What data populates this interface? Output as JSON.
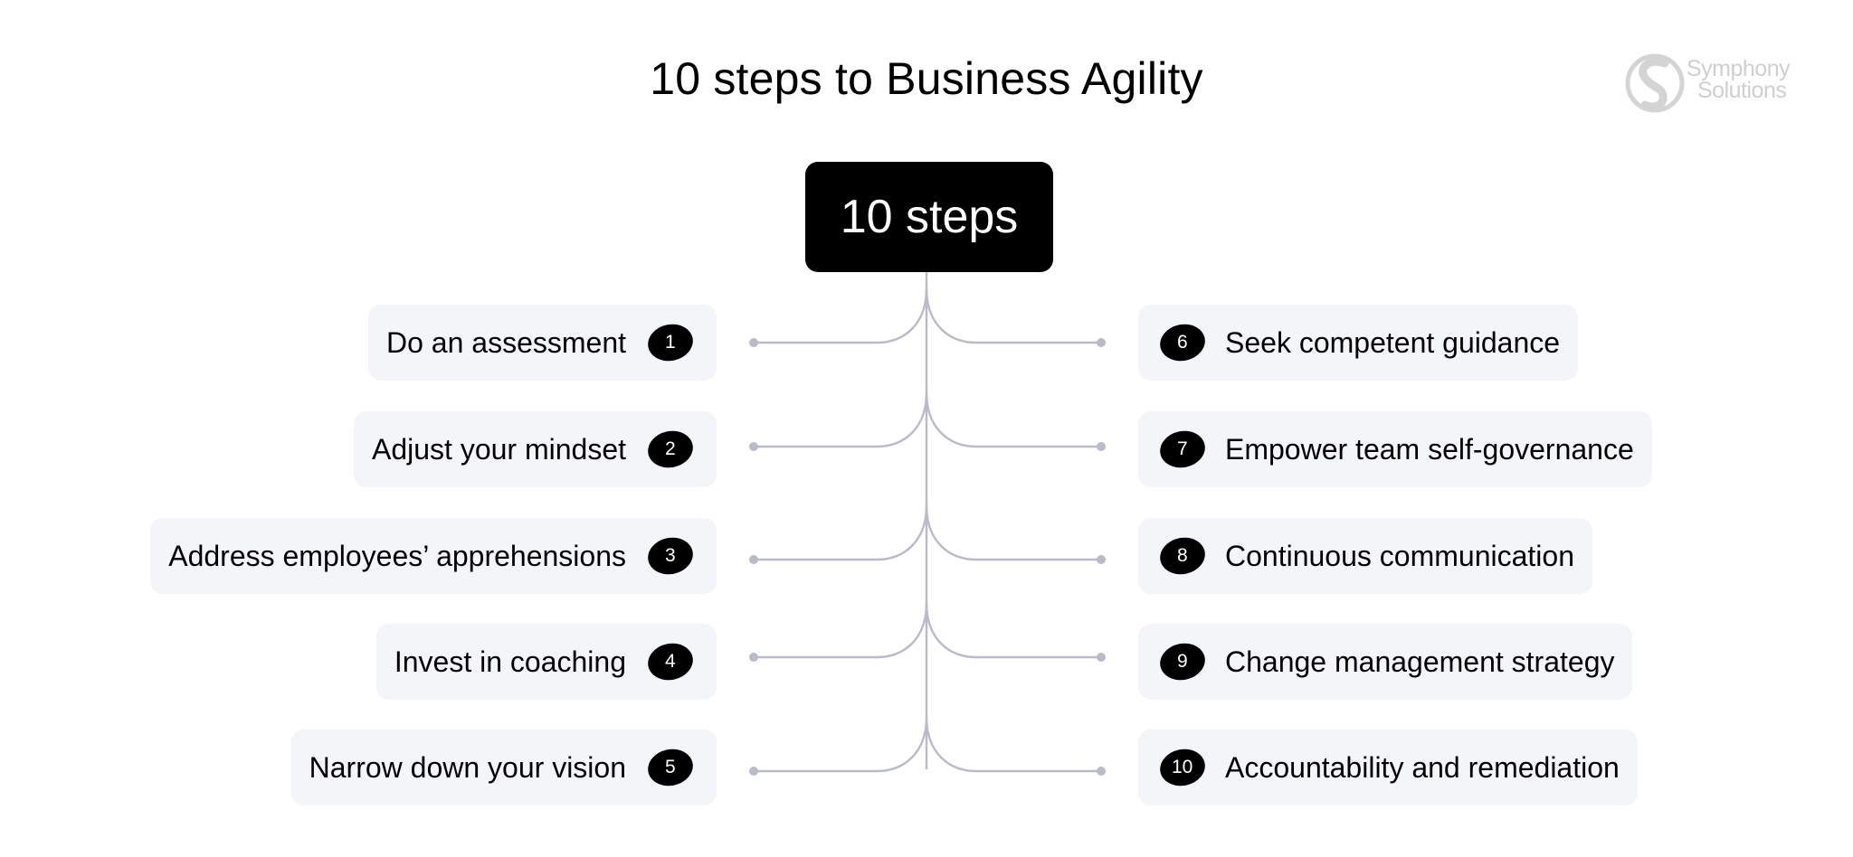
{
  "header": {
    "title": "10 steps to Business Agility",
    "logo": {
      "line1": "Symphony",
      "line2": "Solutions",
      "icon": "symphony-logo-icon",
      "color": "#cfcfcf"
    }
  },
  "center": {
    "label": "10 steps",
    "color": "#000000"
  },
  "colors": {
    "card_bg": "#f4f5f9",
    "connector": "#b9bbc8",
    "badge_bg": "#000000"
  },
  "steps": {
    "left": [
      {
        "number": "1",
        "label": "Do an assessment"
      },
      {
        "number": "2",
        "label": "Adjust your mindset"
      },
      {
        "number": "3",
        "label": "Address employees’ apprehensions"
      },
      {
        "number": "4",
        "label": "Invest in coaching"
      },
      {
        "number": "5",
        "label": "Narrow down your vision"
      }
    ],
    "right": [
      {
        "number": "6",
        "label": "Seek competent guidance"
      },
      {
        "number": "7",
        "label": "Empower team self-governance"
      },
      {
        "number": "8",
        "label": "Continuous communication"
      },
      {
        "number": "9",
        "label": "Change management strategy"
      },
      {
        "number": "10",
        "label": "Accountability and remediation"
      }
    ]
  }
}
